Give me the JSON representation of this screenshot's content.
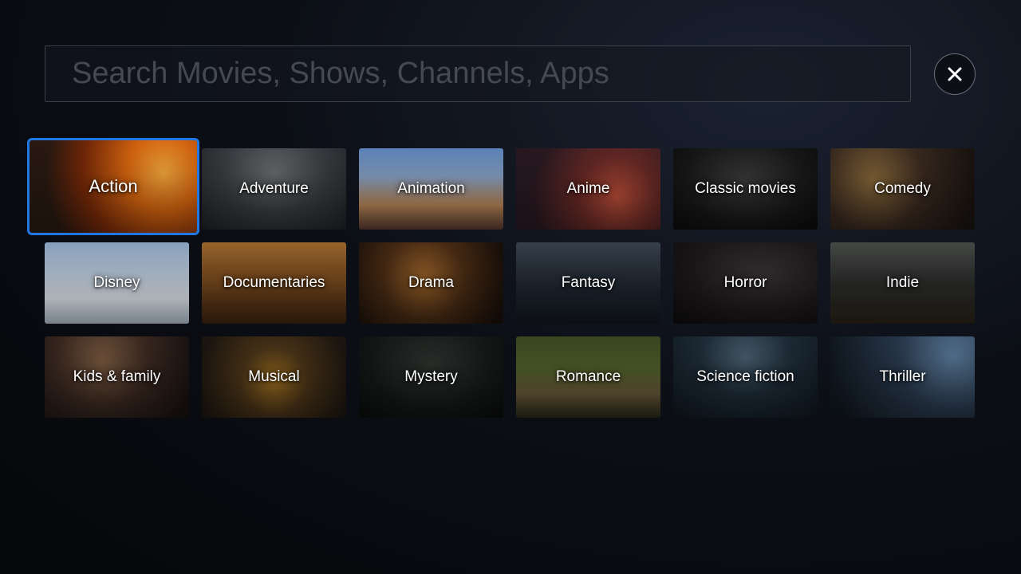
{
  "search": {
    "placeholder": "Search Movies, Shows, Channels, Apps",
    "value": ""
  },
  "close_button": {
    "icon": "close-icon"
  },
  "focused_genre": "Action",
  "accent_color": "#1f78e6",
  "genres": [
    {
      "label": "Action"
    },
    {
      "label": "Adventure"
    },
    {
      "label": "Animation"
    },
    {
      "label": "Anime"
    },
    {
      "label": "Classic movies"
    },
    {
      "label": "Comedy"
    },
    {
      "label": "Disney"
    },
    {
      "label": "Documentaries"
    },
    {
      "label": "Drama"
    },
    {
      "label": "Fantasy"
    },
    {
      "label": "Horror"
    },
    {
      "label": "Indie"
    },
    {
      "label": "Kids & family"
    },
    {
      "label": "Musical"
    },
    {
      "label": "Mystery"
    },
    {
      "label": "Romance"
    },
    {
      "label": "Science fiction"
    },
    {
      "label": "Thriller"
    }
  ]
}
